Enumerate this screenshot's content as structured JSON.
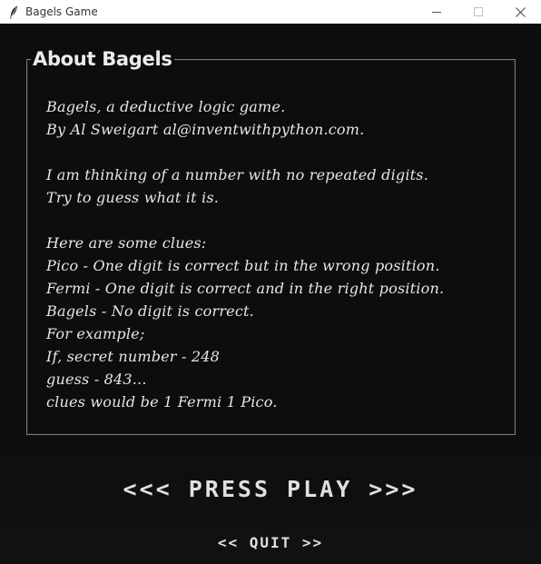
{
  "window": {
    "title": "Bagels Game",
    "icon": "feather-icon",
    "controls": [
      "minimize-icon",
      "maximize-icon",
      "close-icon"
    ]
  },
  "about": {
    "heading": "About Bagels",
    "lines": [
      "Bagels, a deductive logic game.",
      "By Al Sweigart al@inventwithpython.com.",
      "",
      "I am thinking of a number with no repeated digits.",
      "Try to guess what it is.",
      "",
      "Here are some clues:",
      "Pico - One digit is correct but in the wrong position.",
      "Fermi - One digit is correct and in the right position.",
      "Bagels - No digit is correct.",
      "For example;",
      "If, secret number - 248",
      "guess - 843...",
      "clues would be 1 Fermi 1 Pico."
    ]
  },
  "buttons": {
    "play_label": "<<< PRESS PLAY >>>",
    "quit_label": "<< QUIT >>"
  },
  "colors": {
    "background": "#0d0d0d",
    "text": "#e6e6e6",
    "frame_border": "#7a7a7a",
    "titlebar": "#ffffff"
  }
}
